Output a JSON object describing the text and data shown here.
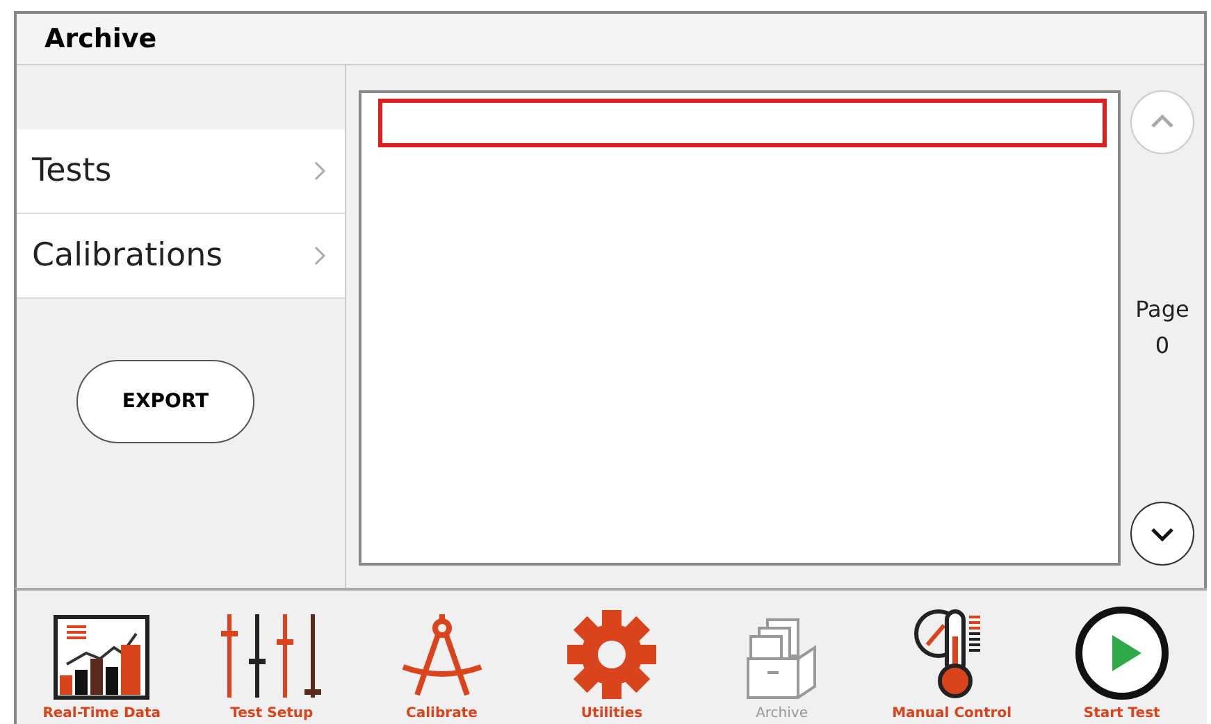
{
  "window": {
    "title": "Archive"
  },
  "sidebar": {
    "items": [
      {
        "label": "Tests",
        "selected": false
      },
      {
        "label": "Calibrations",
        "selected": false
      }
    ],
    "export_button": "EXPORT"
  },
  "list": {
    "rows": [
      {
        "selected": true
      }
    ]
  },
  "pager": {
    "up_disabled": true,
    "down_disabled": false,
    "label": "Page",
    "page": "0"
  },
  "toolbar": [
    {
      "kind": "chart",
      "label": "Real-Time Data",
      "disabled": false
    },
    {
      "kind": "sliders",
      "label": "Test Setup",
      "disabled": false
    },
    {
      "kind": "compass",
      "label": "Calibrate",
      "disabled": false
    },
    {
      "kind": "gear",
      "label": "Utilities",
      "disabled": false
    },
    {
      "kind": "archive",
      "label": "Archive",
      "disabled": true
    },
    {
      "kind": "thermometer",
      "label": "Manual Control",
      "disabled": false
    },
    {
      "kind": "play",
      "label": "Start Test",
      "disabled": false
    }
  ]
}
